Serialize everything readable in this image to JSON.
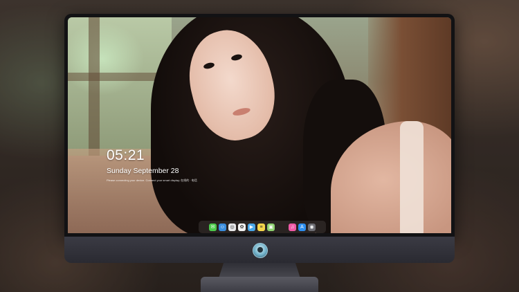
{
  "lock_screen": {
    "time": "05:21",
    "date": "Sunday September  28",
    "subline": "Please connecting your device. Connect your smart display; 在线的 · 电话"
  },
  "dock": {
    "items": [
      {
        "name": "messages-icon",
        "glyph": "✉",
        "color": "#4cc94b"
      },
      {
        "name": "finder-icon",
        "glyph": "☺",
        "color": "#3a8dde"
      },
      {
        "name": "safari-icon",
        "glyph": "◎",
        "color": "#e8e8ea"
      },
      {
        "name": "photos-icon",
        "glyph": "✿",
        "color": "#f2f2f2"
      },
      {
        "name": "clapper-icon",
        "glyph": "▶",
        "color": "#49a7e8"
      },
      {
        "name": "notes-icon",
        "glyph": "≡",
        "color": "#f5d54a"
      },
      {
        "name": "gallery-icon",
        "glyph": "▣",
        "color": "#8ccf6e"
      },
      {
        "name": "music-icon",
        "glyph": "♫",
        "color": "#f05aa6"
      },
      {
        "name": "app-store-icon",
        "glyph": "A",
        "color": "#2d8ff0"
      },
      {
        "name": "camera-icon",
        "glyph": "◉",
        "color": "#6c6c72"
      }
    ]
  },
  "colors": {
    "bezel": "#121214",
    "chin": "#34343c",
    "clock_text": "#ffffff"
  }
}
